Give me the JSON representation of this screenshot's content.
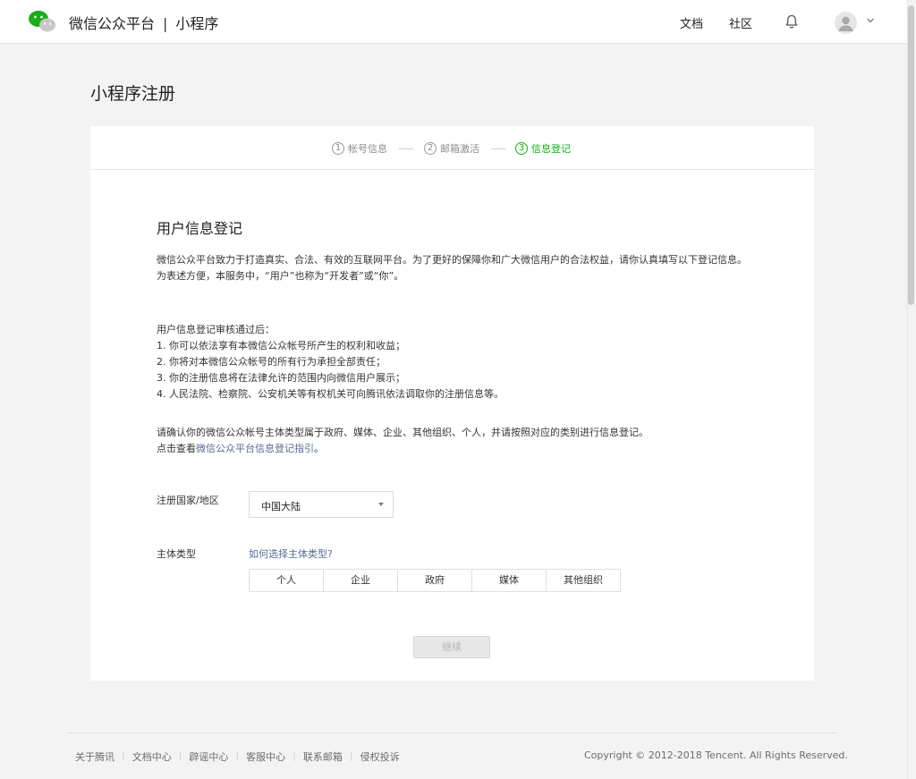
{
  "header": {
    "brand_name": "微信公众平台",
    "brand_sep": "|",
    "brand_product": "小程序",
    "nav": [
      "文档",
      "社区"
    ]
  },
  "page": {
    "title": "小程序注册"
  },
  "steps": [
    {
      "num": "1",
      "label": "帐号信息"
    },
    {
      "num": "2",
      "label": "邮箱激活"
    },
    {
      "num": "3",
      "label": "信息登记"
    }
  ],
  "form": {
    "section_title": "用户信息登记",
    "intro": [
      "微信公众平台致力于打造真实、合法、有效的互联网平台。为了更好的保障你和广大微信用户的合法权益，请你认真填写以下登记信息。",
      "为表述方便，本服务中，“用户”也称为“开发者”或“你”。"
    ],
    "after_heading": "用户信息登记审核通过后：",
    "after_items": [
      "1. 你可以依法享有本微信公众帐号所产生的权利和收益；",
      "2. 你将对本微信公众帐号的所有行为承担全部责任；",
      "3. 你的注册信息将在法律允许的范围内向微信用户展示；",
      "4. 人民法院、检察院、公安机关等有权机关可向腾讯依法调取你的注册信息等。"
    ],
    "confirm_text": "请确认你的微信公众帐号主体类型属于政府、媒体、企业、其他组织、个人，并请按照对应的类别进行信息登记。",
    "guide_prefix": "点击查看",
    "guide_link": "微信公众平台信息登记指引",
    "guide_suffix": "。",
    "country_label": "注册国家/地区",
    "country_value": "中国大陆",
    "type_label": "主体类型",
    "type_help": "如何选择主体类型?",
    "types": [
      "个人",
      "企业",
      "政府",
      "媒体",
      "其他组织"
    ],
    "continue_label": "继续"
  },
  "footer": {
    "links": [
      "关于腾讯",
      "文档中心",
      "辟谣中心",
      "客服中心",
      "联系邮箱",
      "侵权投诉"
    ],
    "copyright": "Copyright © 2012-2018 Tencent. All Rights Reserved."
  },
  "colors": {
    "accent_green": "#1aad19",
    "link_blue": "#576b95"
  }
}
